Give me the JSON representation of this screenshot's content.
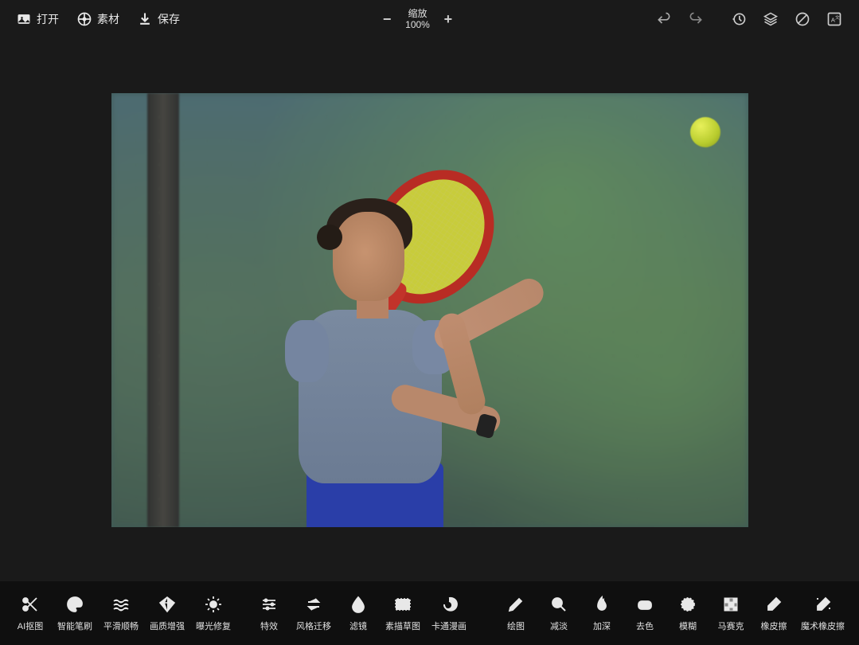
{
  "top": {
    "open": "打开",
    "material": "素材",
    "save": "保存"
  },
  "zoom": {
    "label": "缩放",
    "value": "100%",
    "minus": "−",
    "plus": "+"
  },
  "tools": {
    "ai_cutout": "AI抠图",
    "smart_brush": "智能笔刷",
    "smooth": "平滑顺畅",
    "quality_enhance": "画质增强",
    "exposure_fix": "曝光修复",
    "effects": "特效",
    "style_transfer": "风格迁移",
    "filter": "滤镜",
    "sketch": "素描草图",
    "cartoon": "卡通漫画",
    "draw": "绘图",
    "dodge": "减淡",
    "burn": "加深",
    "tint": "去色",
    "blur": "模糊",
    "mosaic": "马赛克",
    "eraser": "橡皮擦",
    "magic_eraser": "魔术橡皮擦"
  }
}
